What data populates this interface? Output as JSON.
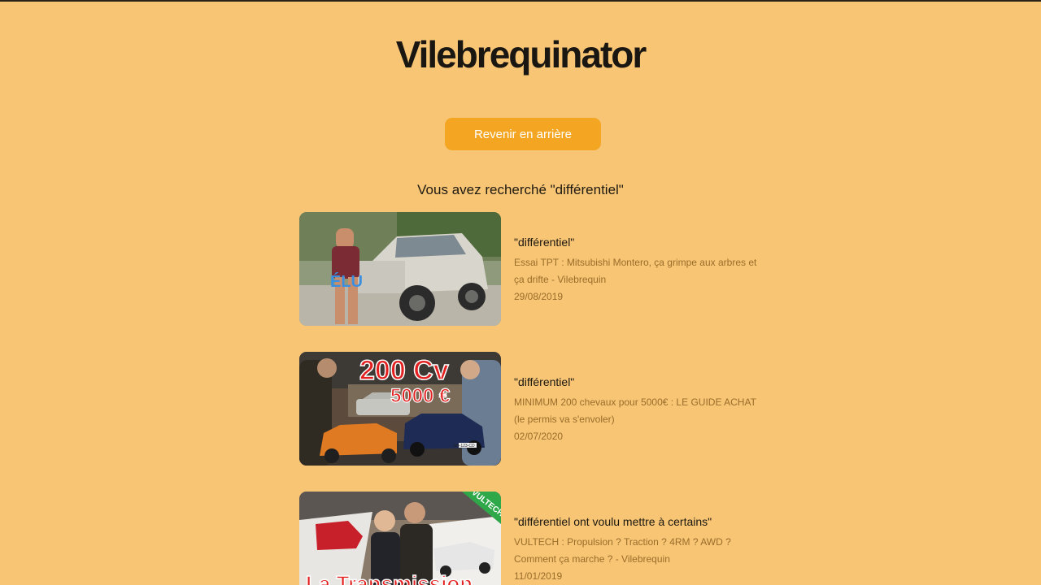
{
  "header": {
    "title": "Vilebrequinator"
  },
  "actions": {
    "back_label": "Revenir en arrière"
  },
  "search": {
    "heading": "Vous avez recherché \"différentiel\""
  },
  "results": [
    {
      "match": "\"différentiel\"",
      "title": "Essai TPT : Mitsubishi Montero, ça grimpe aux arbres et ça drifte - Vilebrequin",
      "date": "29/08/2019",
      "thumb_text": "ÉLU"
    },
    {
      "match": "\"différentiel\"",
      "title": "MINIMUM 200 chevaux pour 5000€ : LE GUIDE ACHAT (le permis va s'envoler)",
      "date": "02/07/2020",
      "thumb_text_1": "200 Cv",
      "thumb_text_2": "5000 €",
      "plate_text": "AB-123-CD"
    },
    {
      "match": "\"différentiel ont voulu mettre à certains\"",
      "title": "VULTECH : Propulsion ? Traction ? 4RM ? AWD ? Comment ça marche ? - Vilebrequin",
      "date": "11/01/2019",
      "thumb_text": "La Transmission",
      "thumb_badge": "VULTECH"
    }
  ]
}
